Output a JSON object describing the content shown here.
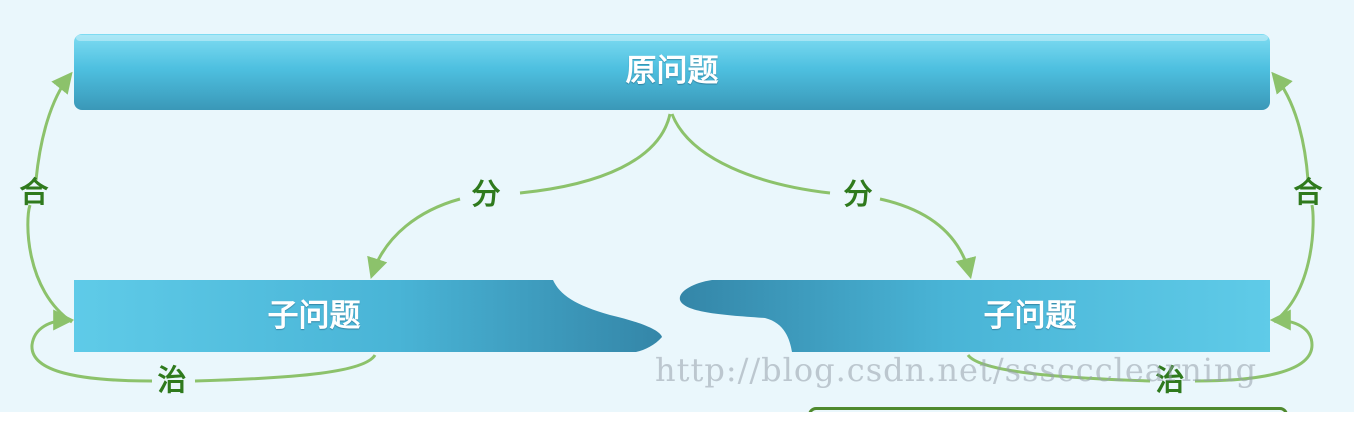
{
  "diagram": {
    "root": {
      "label": "原问题"
    },
    "left_child": {
      "label": "子问题"
    },
    "right_child": {
      "label": "子问题"
    },
    "edges": {
      "split_left": "分",
      "split_right": "分",
      "merge_left": "合",
      "merge_right": "合",
      "solve_left": "治",
      "solve_right": "治"
    },
    "watermark": "http://blog.csdn.net/sssccclearning",
    "colors": {
      "box_light": "#5ecbe8",
      "box_dark": "#3d9fc0",
      "arrow": "#8cc26b",
      "label_green": "#2f7a1d",
      "background": "#eaf7fc"
    }
  }
}
